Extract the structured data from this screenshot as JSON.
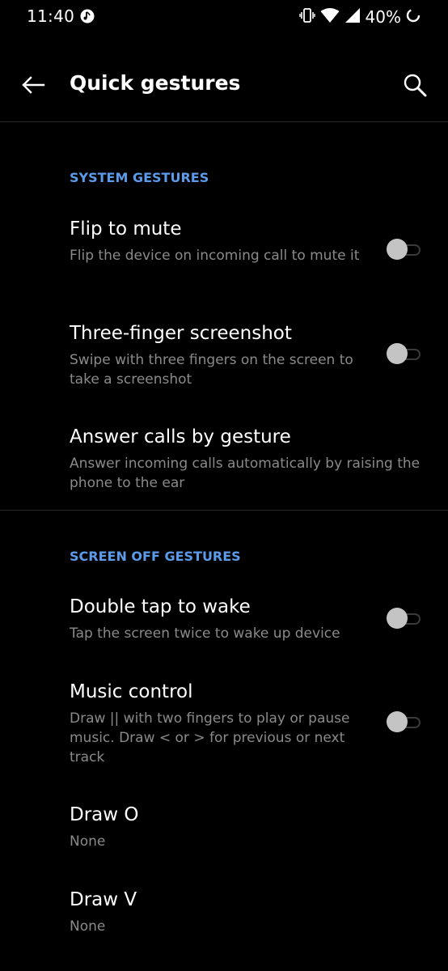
{
  "status_bar": {
    "time": "11:40",
    "battery": "40%",
    "icons": [
      "music-note-icon",
      "vibrate-icon",
      "wifi-icon",
      "signal-icon",
      "battery-saver-icon"
    ]
  },
  "app_bar": {
    "title": "Quick gestures",
    "back_icon": "arrow-left-icon",
    "search_icon": "search-icon"
  },
  "sections": [
    {
      "header": "SYSTEM GESTURES",
      "items": [
        {
          "title": "Flip to mute",
          "summary": "Flip the device on incoming call to mute it",
          "toggle": true,
          "checked": false
        },
        {
          "title": "Three-finger screenshot",
          "summary": "Swipe with three fingers on the screen to take a screenshot",
          "toggle": true,
          "checked": false
        },
        {
          "title": "Answer calls by gesture",
          "summary": "Answer incoming calls automatically by raising the phone to the ear",
          "toggle": false
        }
      ]
    },
    {
      "header": "SCREEN OFF GESTURES",
      "items": [
        {
          "title": "Double tap to wake",
          "summary": "Tap the screen twice to wake up device",
          "toggle": true,
          "checked": false
        },
        {
          "title": "Music control",
          "summary": "Draw || with two fingers to play or pause music. Draw < or > for previous or next track",
          "toggle": true,
          "checked": false
        },
        {
          "title": "Draw O",
          "summary": "None",
          "toggle": false
        },
        {
          "title": "Draw V",
          "summary": "None",
          "toggle": false
        }
      ]
    }
  ],
  "colors": {
    "background": "#000000",
    "accent": "#5b9bea",
    "title_text": "#ffffff",
    "summary_text": "#8a8a8a",
    "toggle_thumb_off": "#c4c4c4"
  }
}
